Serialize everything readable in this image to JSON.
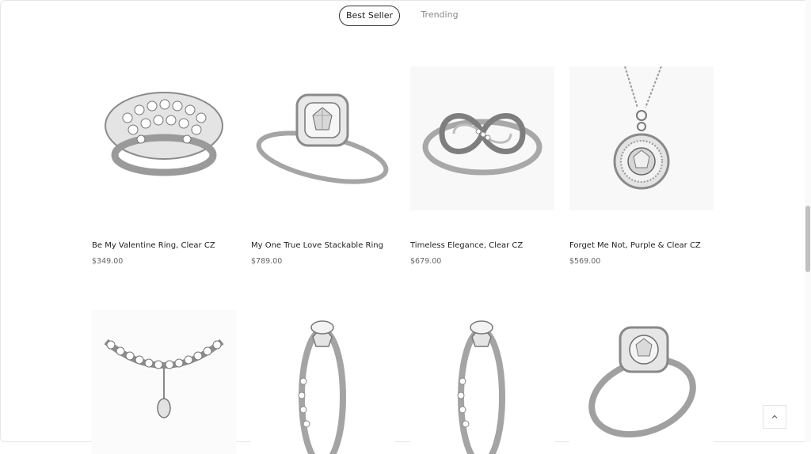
{
  "tabs": [
    {
      "label": "Best Seller",
      "active": true
    },
    {
      "label": "Trending",
      "active": false
    }
  ],
  "products": [
    {
      "title": "Be My Valentine Ring, Clear CZ",
      "price": "$349.00",
      "icon": "cluster-ring-icon"
    },
    {
      "title": "My One True Love Stackable Ring",
      "price": "$789.00",
      "icon": "halo-ring-icon"
    },
    {
      "title": "Timeless Elegance, Clear CZ",
      "price": "$679.00",
      "icon": "infinity-ring-icon"
    },
    {
      "title": "Forget Me Not, Purple & Clear CZ",
      "price": "$569.00",
      "icon": "pendant-necklace-icon"
    },
    {
      "title": "",
      "price": "",
      "icon": "tiara-icon"
    },
    {
      "title": "",
      "price": "",
      "icon": "solitaire-ring-icon"
    },
    {
      "title": "",
      "price": "",
      "icon": "solitaire-ring-icon"
    },
    {
      "title": "",
      "price": "",
      "icon": "vintage-halo-ring-icon"
    }
  ],
  "back_to_top_icon": "chevron-up-icon"
}
